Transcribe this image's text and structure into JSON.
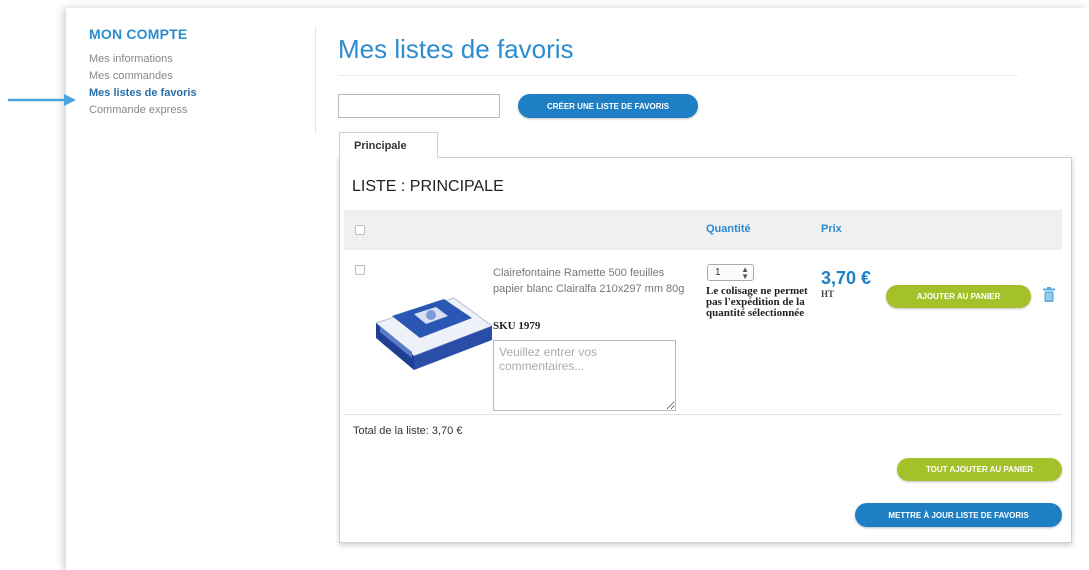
{
  "sidebar": {
    "title": "MON COMPTE",
    "items": [
      {
        "label": "Mes informations"
      },
      {
        "label": "Mes commandes"
      },
      {
        "label": "Mes listes de favoris"
      },
      {
        "label": "Commande express"
      }
    ]
  },
  "main": {
    "title": "Mes listes de favoris",
    "new_list_input": {
      "value": "",
      "placeholder": ""
    },
    "create_button": "CRÉER UNE LISTE DE FAVORIS",
    "tabs": [
      {
        "label": "Principale"
      }
    ],
    "list": {
      "heading": "LISTE : PRINCIPALE",
      "columns": {
        "quantity": "Quantité",
        "price": "Prix"
      },
      "items": [
        {
          "name": "Clairefontaine Ramette 500 feuilles papier blanc Clairalfa 210x297 mm 80g",
          "sku": "SKU 1979",
          "comment_placeholder": "Veuillez entrer vos commentaires...",
          "quantity": "1",
          "quantity_warning": "Le colisage ne permet pas l'expédition de la quantité sélectionnée",
          "price": "3,70 €",
          "price_suffix": "HT",
          "add_to_cart": "AJOUTER AU PANIER",
          "delete_icon": "trash-icon"
        }
      ],
      "total": "Total de la liste: 3,70 €"
    },
    "add_all_button": "TOUT AJOUTER AU PANIER",
    "update_button": "METTRE À JOUR LISTE DE FAVORIS"
  },
  "icons": {
    "arrow": "arrow-right-icon",
    "product": "product-image",
    "quantity_spinner": "spinner-icon"
  },
  "colors": {
    "accent": "#1e7fc4",
    "green": "#a5c12a",
    "arrow": "#4aa3df"
  }
}
